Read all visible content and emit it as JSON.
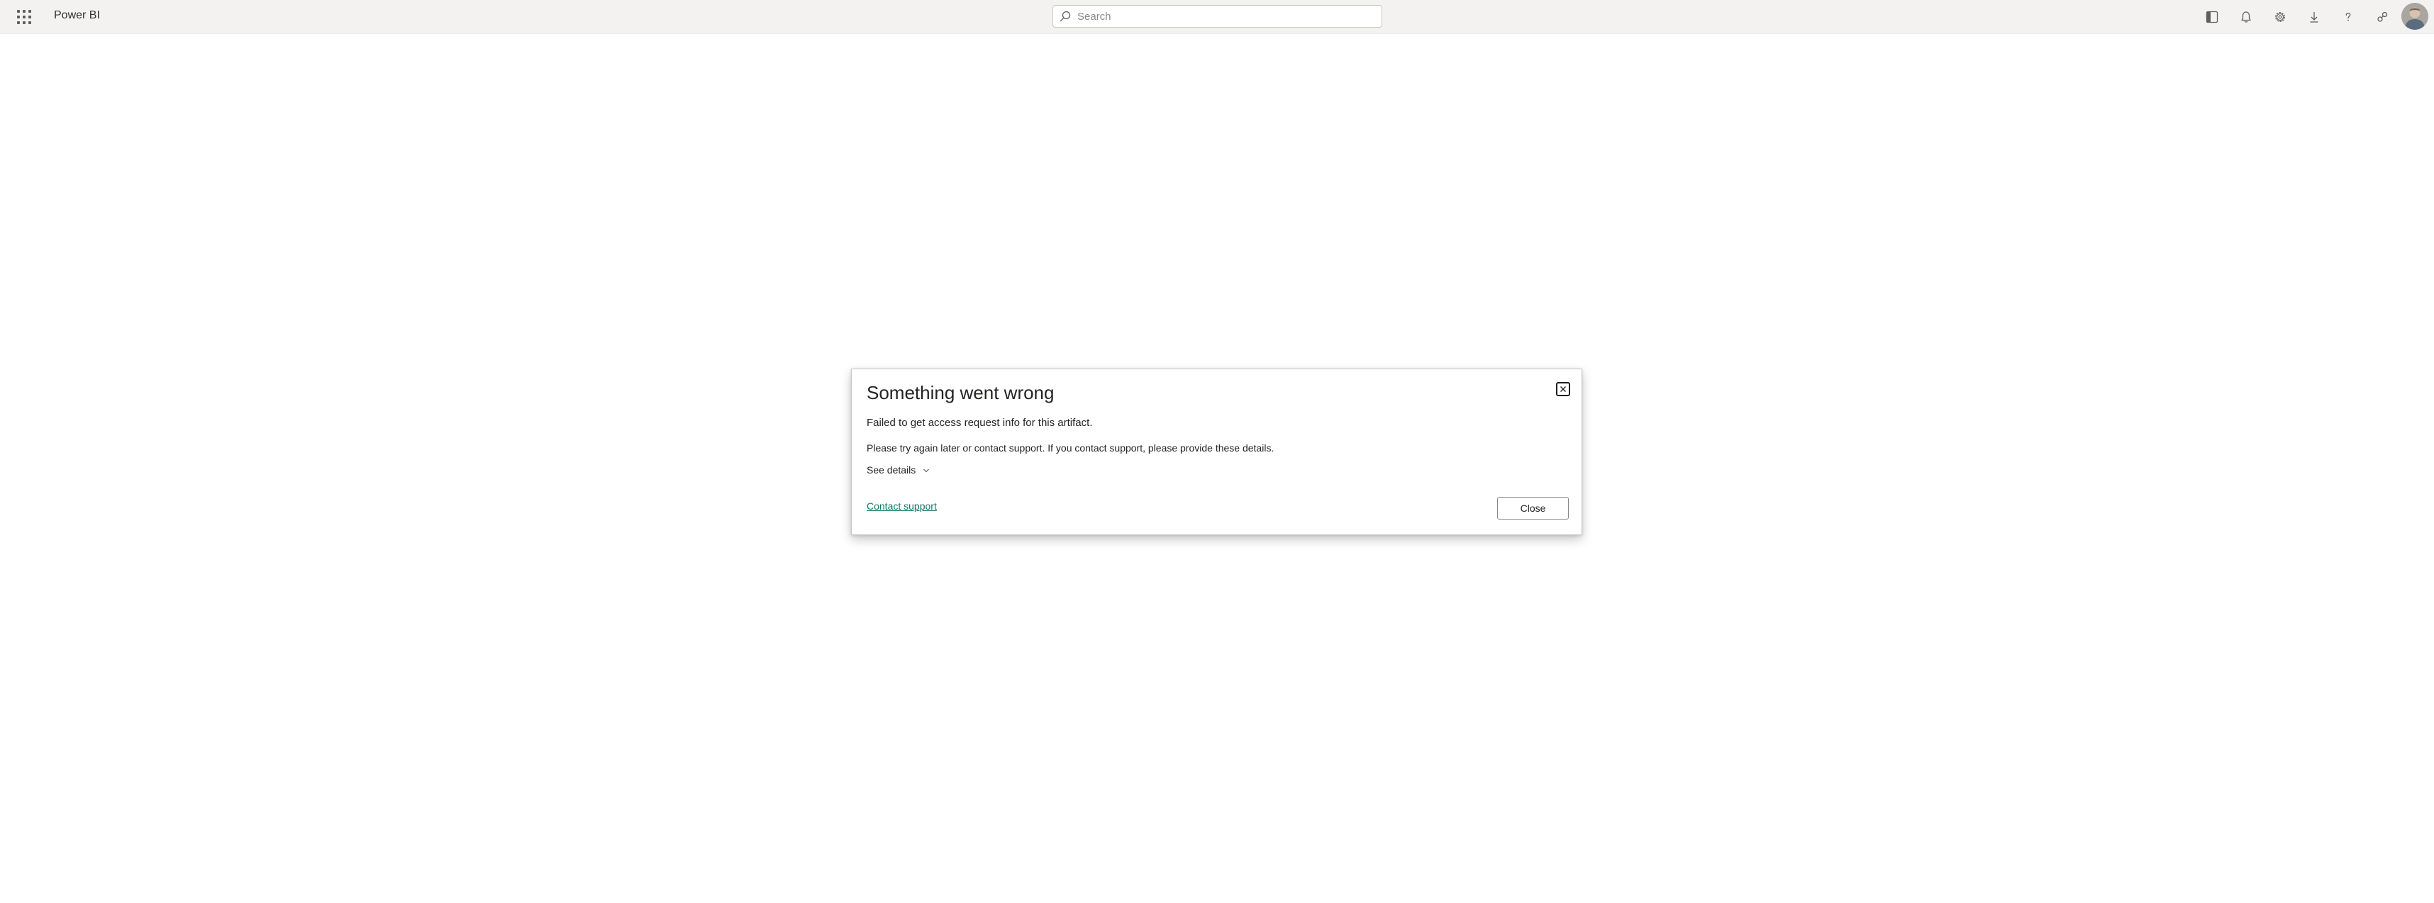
{
  "header": {
    "app_title": "Power BI",
    "search": {
      "placeholder": "Search",
      "value": ""
    },
    "icons": [
      "waffle-icon",
      "panel-icon",
      "bell-icon",
      "gear-icon",
      "download-icon",
      "help-icon",
      "share-icon",
      "avatar"
    ]
  },
  "dialog": {
    "title": "Something went wrong",
    "message": "Failed to get access request info for this artifact.",
    "hint": "Please try again later or contact support. If you contact support, please provide these details.",
    "details_label": "See details",
    "support_link": "Contact support",
    "close_button": "Close"
  },
  "colors": {
    "topbar_bg": "#f3f2f1",
    "link": "#117865",
    "text": "#252423"
  }
}
